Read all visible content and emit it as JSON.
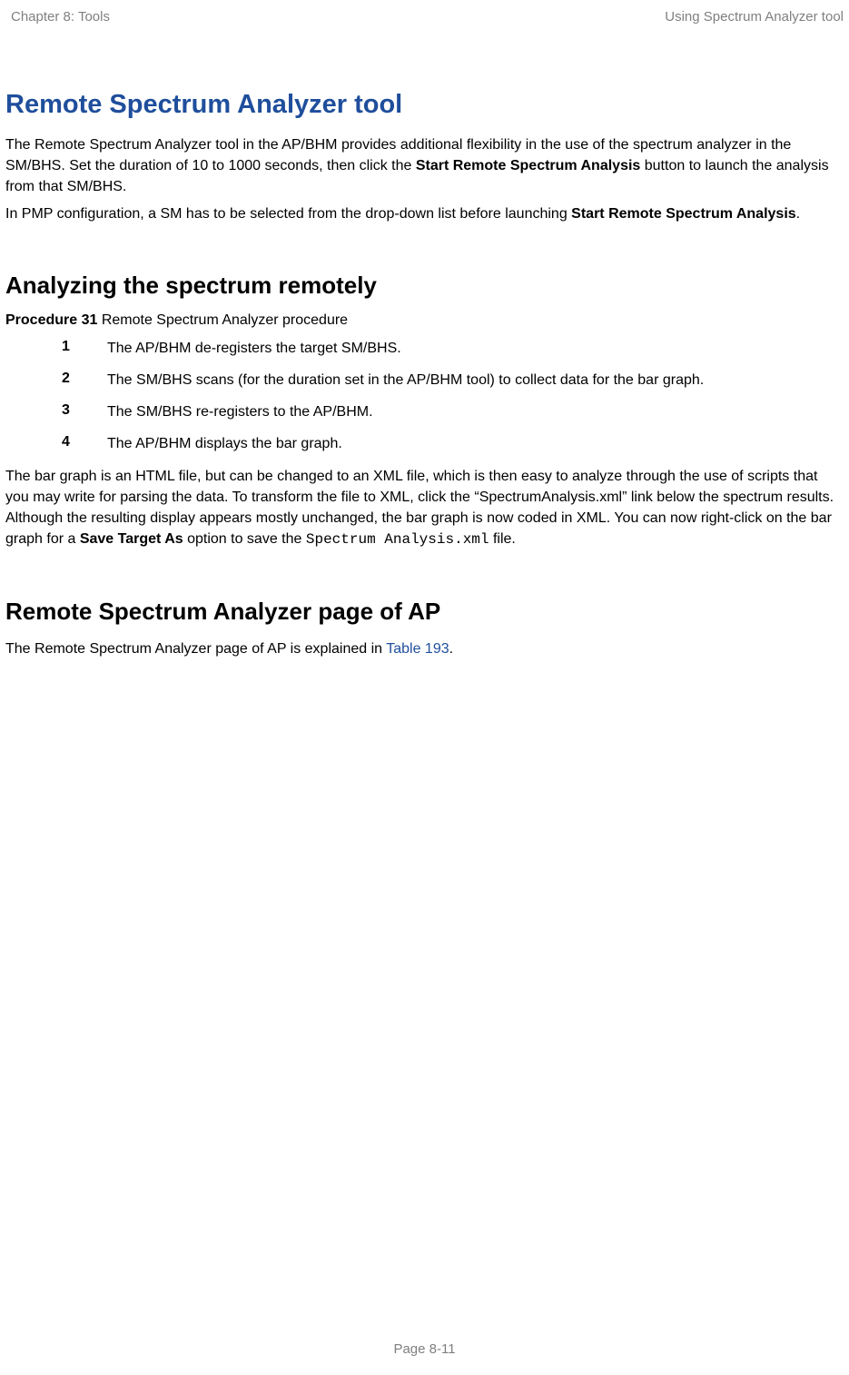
{
  "header": {
    "left": "Chapter 8:  Tools",
    "right": "Using Spectrum Analyzer tool"
  },
  "section1": {
    "title": "Remote Spectrum Analyzer tool",
    "p1_a": "The Remote Spectrum Analyzer tool in the AP/BHM provides additional flexibility in the use of the spectrum analyzer in the SM/BHS. Set the duration of 10 to 1000 seconds, then click the ",
    "p1_b": "Start Remote Spectrum Analysis",
    "p1_c": " button to launch the analysis from that SM/BHS.",
    "p2_a": "In PMP configuration, a SM has to be selected from the drop-down list before launching ",
    "p2_b": "Start Remote Spectrum Analysis",
    "p2_c": "."
  },
  "section2": {
    "title": "Analyzing the spectrum remotely",
    "procedure_bold": "Procedure 31",
    "procedure_text": " Remote Spectrum Analyzer procedure",
    "steps": [
      {
        "n": "1",
        "t": "The AP/BHM de-registers the target SM/BHS."
      },
      {
        "n": "2",
        "t": "The SM/BHS scans (for the duration set in the AP/BHM tool) to collect data for the bar graph."
      },
      {
        "n": "3",
        "t": "The SM/BHS re-registers to the AP/BHM."
      },
      {
        "n": "4",
        "t": "The AP/BHM displays the bar graph."
      }
    ],
    "p3_a": "The bar graph is an HTML file, but can be changed to an XML file, which is then easy to analyze through the use of scripts that you may write for parsing the data. To transform the file to XML, click the “SpectrumAnalysis.xml” link below the spectrum results. Although the resulting display appears mostly unchanged, the bar graph is now coded in XML. You can now right-click on the bar graph for a ",
    "p3_b": "Save Target As",
    "p3_c": " option to save the ",
    "p3_mono": "Spectrum Analysis.xml",
    "p3_d": " file."
  },
  "section3": {
    "title": "Remote Spectrum Analyzer page of AP",
    "p1_a": "The Remote Spectrum Analyzer page of AP is explained in ",
    "p1_link": "Table 193",
    "p1_b": "."
  },
  "footer": "Page 8-11"
}
